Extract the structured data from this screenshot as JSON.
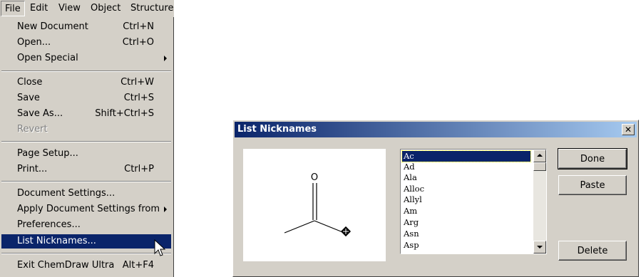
{
  "menubar": {
    "items": [
      "File",
      "Edit",
      "View",
      "Object",
      "Structure"
    ]
  },
  "file_menu": {
    "items": [
      {
        "label": "New Document",
        "shortcut": "Ctrl+N"
      },
      {
        "label": "Open...",
        "shortcut": "Ctrl+O"
      },
      {
        "label": "Open Special",
        "shortcut": "",
        "submenu": true
      },
      {
        "label": "Close",
        "shortcut": "Ctrl+W"
      },
      {
        "label": "Save",
        "shortcut": "Ctrl+S"
      },
      {
        "label": "Save As...",
        "shortcut": "Shift+Ctrl+S"
      },
      {
        "label": "Revert",
        "shortcut": "",
        "disabled": true
      },
      {
        "label": "Page Setup...",
        "shortcut": ""
      },
      {
        "label": "Print...",
        "shortcut": "Ctrl+P"
      },
      {
        "label": "Document Settings...",
        "shortcut": ""
      },
      {
        "label": "Apply Document Settings from",
        "shortcut": "",
        "submenu": true
      },
      {
        "label": "Preferences...",
        "shortcut": ""
      },
      {
        "label": "List Nicknames...",
        "shortcut": "",
        "highlighted": true
      },
      {
        "label": "Exit ChemDraw Ultra",
        "shortcut": "Alt+F4"
      }
    ]
  },
  "dialog": {
    "title": "List Nicknames",
    "close_glyph": "✕",
    "structure": {
      "atom_label": "O"
    },
    "nicknames": [
      "Ac",
      "Ad",
      "Ala",
      "Alloc",
      "Allyl",
      "Am",
      "Arg",
      "Asn",
      "Asp"
    ],
    "selected_index": 0,
    "buttons": {
      "done": "Done",
      "paste": "Paste",
      "delete": "Delete"
    }
  },
  "colors": {
    "highlight": "#0a246a",
    "face": "#d4d0c8"
  }
}
